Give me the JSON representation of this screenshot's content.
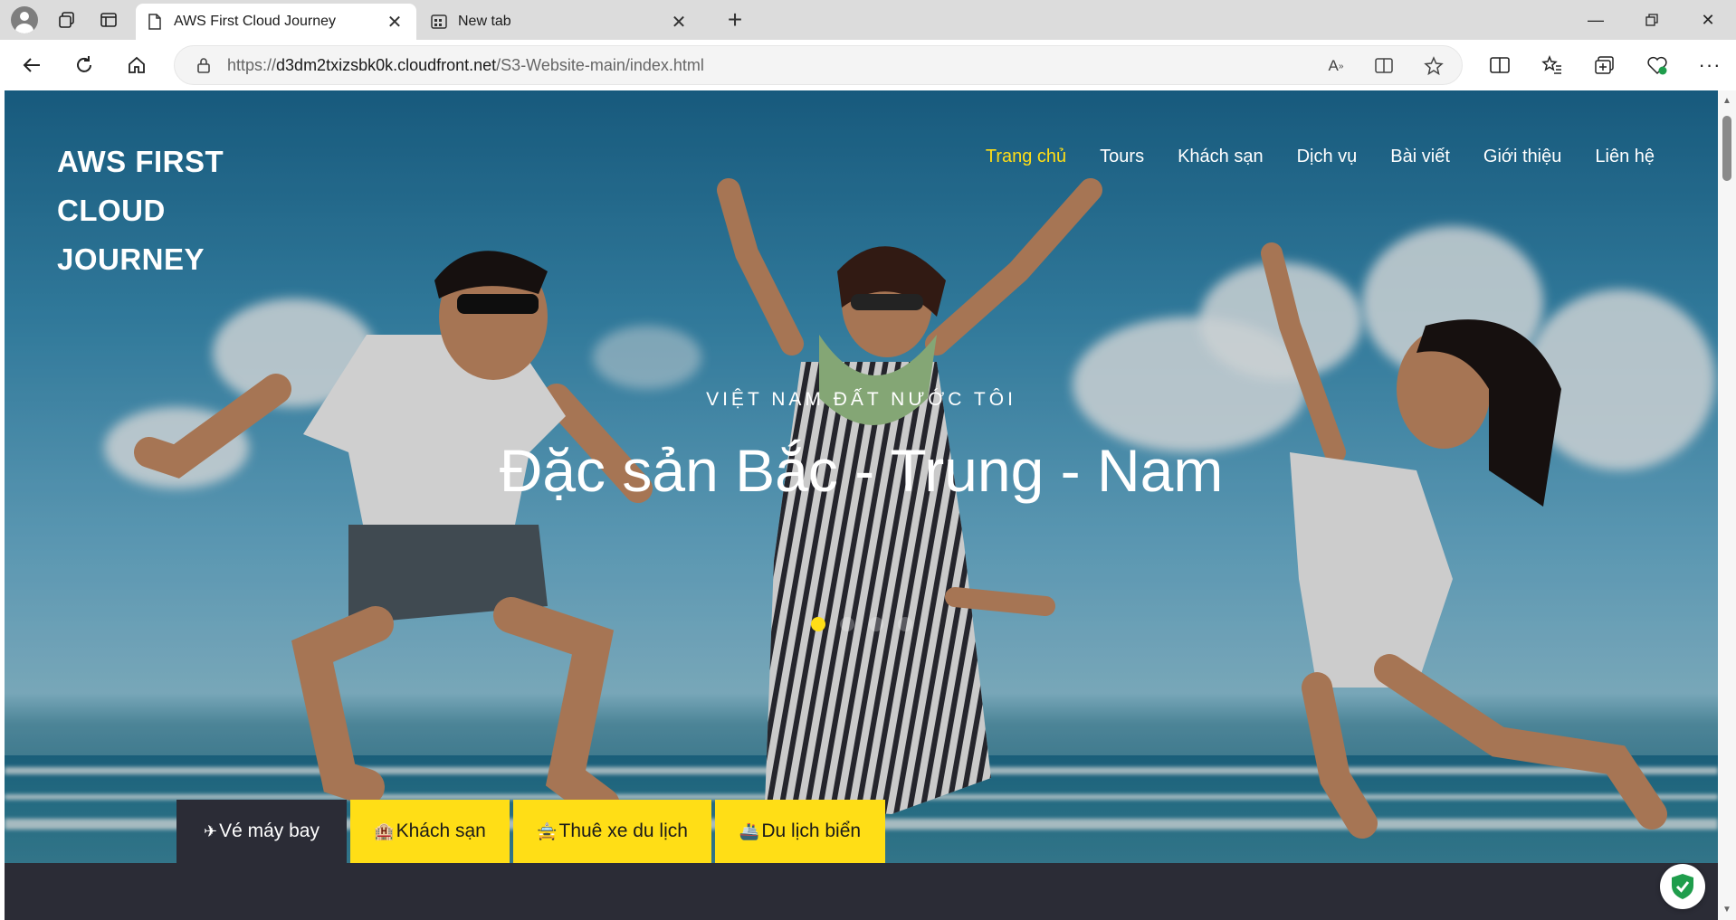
{
  "browser": {
    "tabs": [
      {
        "title": "AWS First Cloud Journey",
        "icon": "page-icon",
        "active": true
      },
      {
        "title": "New tab",
        "icon": "newtab-icon",
        "active": false
      }
    ],
    "url": {
      "scheme": "https://",
      "host": "d3dm2txizsbk0k.cloudfront.net",
      "path": "/S3-Website-main/index.html"
    }
  },
  "site": {
    "logo": "AWS FIRST CLOUD JOURNEY",
    "nav": [
      {
        "label": "Trang chủ",
        "active": true
      },
      {
        "label": "Tours"
      },
      {
        "label": "Khách sạn"
      },
      {
        "label": "Dịch vụ"
      },
      {
        "label": "Bài viết"
      },
      {
        "label": "Giới thiệu"
      },
      {
        "label": "Liên hệ"
      }
    ],
    "hero": {
      "subtitle": "VIỆT NAM ĐẤT NƯỚC TÔI",
      "title": "Đặc sản Bắc - Trung - Nam",
      "slide_count": 4,
      "active_slide": 1
    },
    "categories": [
      {
        "label": "Vé máy bay",
        "icon": "airplane-icon",
        "active": true
      },
      {
        "label": "Khách sạn",
        "icon": "hotel-icon"
      },
      {
        "label": "Thuê xe du lịch",
        "icon": "car-icon"
      },
      {
        "label": "Du lịch biển",
        "icon": "ship-icon"
      }
    ],
    "colors": {
      "accent": "#ffde16",
      "dark": "#2b2c36"
    }
  }
}
